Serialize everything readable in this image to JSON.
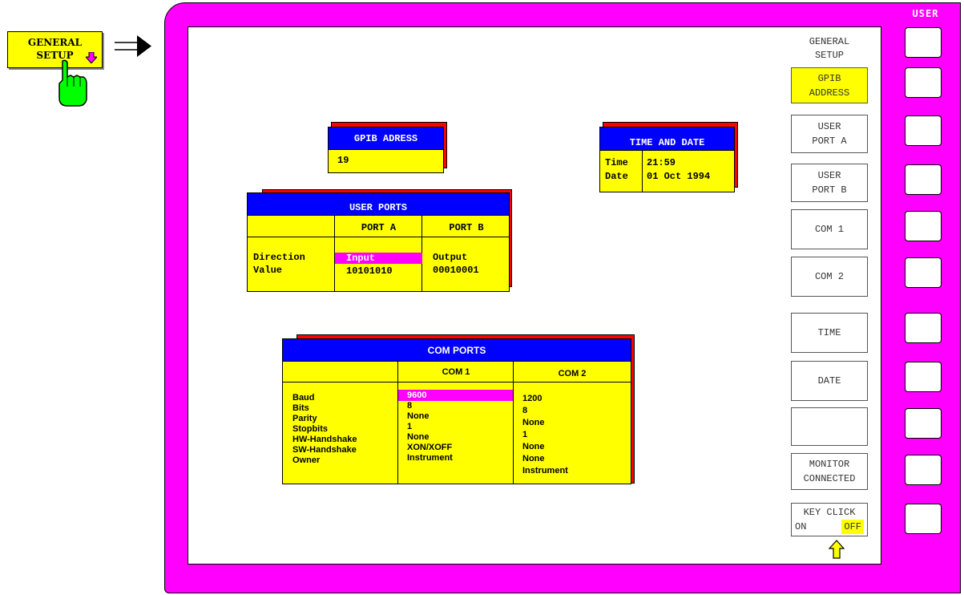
{
  "hardkey": {
    "line1": "GENERAL",
    "line2": "SETUP",
    "arrow_icon": "down-arrow-icon",
    "color": "#ffff00"
  },
  "user_label": "USER",
  "softkeys": {
    "title_line1": "GENERAL",
    "title_line2": "SETUP",
    "gpib_line1": "GPIB",
    "gpib_line2": "ADDRESS",
    "userporta_line1": "USER",
    "userporta_line2": "PORT A",
    "userportb_line1": "USER",
    "userportb_line2": "PORT B",
    "com1": "COM 1",
    "com2": "COM 2",
    "time": "TIME",
    "date": "DATE",
    "blank": "",
    "monitor_line1": "MONITOR",
    "monitor_line2": "CONNECTED",
    "keyclick_line1": "KEY CLICK",
    "keyclick_on": "ON",
    "keyclick_off": "OFF"
  },
  "gpib": {
    "title": "GPIB ADRESS",
    "value": "19"
  },
  "time_date": {
    "title": "TIME AND DATE",
    "time_label": "Time",
    "time_value": "21:59",
    "date_label": "Date",
    "date_value": "01 Oct 1994"
  },
  "user_ports": {
    "title": "USER PORTS",
    "col_a": "PORT A",
    "col_b": "PORT B",
    "row1_label": "Direction",
    "row1_a": "Input",
    "row1_b": "Output",
    "row2_label": "Value",
    "row2_a": "10101010",
    "row2_b": "00010001"
  },
  "com_ports": {
    "title": "COM PORTS",
    "col1": "COM 1",
    "col2": "COM 2",
    "labels": [
      "Baud",
      "Bits",
      "Parity",
      "Stopbits",
      "HW-Handshake",
      "SW-Handshake",
      "Owner"
    ],
    "com1": [
      "9600",
      "8",
      "None",
      "1",
      "None",
      "XON/XOFF",
      "Instrument"
    ],
    "com2": [
      "1200",
      "8",
      "None",
      "1",
      "None",
      "None",
      "Instrument"
    ]
  },
  "colors": {
    "frame": "#ff00ff",
    "panel": "#ffff00",
    "header": "#0000ff",
    "shadow": "#ff0000",
    "highlight": "#ff00ff"
  }
}
